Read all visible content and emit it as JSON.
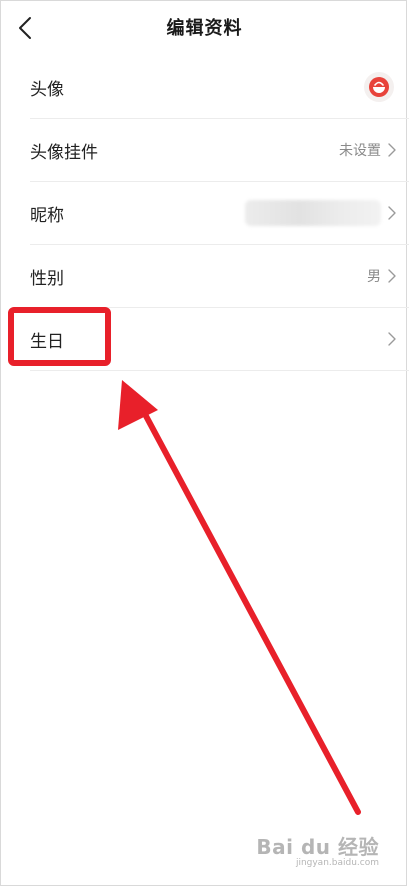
{
  "header": {
    "title": "编辑资料"
  },
  "rows": [
    {
      "label": "头像"
    },
    {
      "label": "头像挂件",
      "value": "未设置"
    },
    {
      "label": "昵称"
    },
    {
      "label": "性别",
      "value": "男"
    },
    {
      "label": "生日"
    }
  ],
  "annotation": {
    "color": "#e8202a"
  },
  "watermark": {
    "brand": "Bai du 经验",
    "url": "jingyan.baidu.com"
  }
}
